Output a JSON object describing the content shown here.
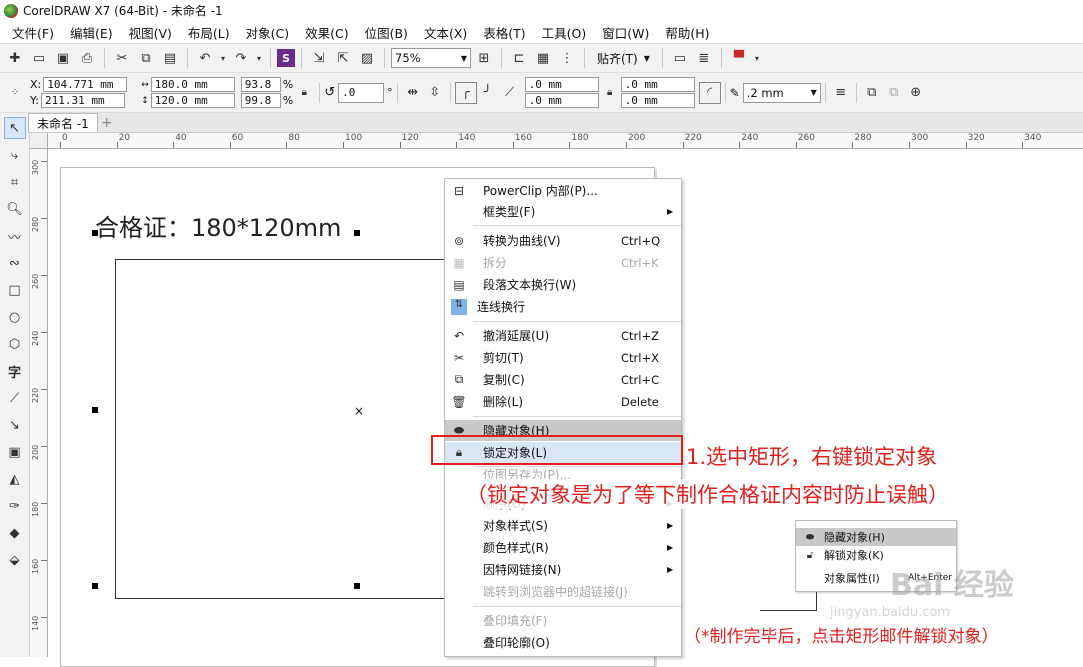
{
  "window": {
    "title": "CorelDRAW X7 (64-Bit) - 未命名 -1"
  },
  "menubar": [
    "文件(F)",
    "编辑(E)",
    "视图(V)",
    "布局(L)",
    "对象(C)",
    "效果(C)",
    "位图(B)",
    "文本(X)",
    "表格(T)",
    "工具(O)",
    "窗口(W)",
    "帮助(H)"
  ],
  "toolbar": {
    "zoom": "75%",
    "snap_label": "贴齐(T)"
  },
  "propbar": {
    "x_label": "X:",
    "x": "104.771 mm",
    "y_label": "Y:",
    "y": "211.31 mm",
    "width": "180.0 mm",
    "height": "120.0 mm",
    "scale_w": "93.8",
    "scale_h": "99.8",
    "percent": "%",
    "rotation": ".0",
    "degree": "°",
    "corner_tl": ".0 mm",
    "corner_bl": ".0 mm",
    "corner_tr": ".0 mm",
    "corner_br": ".0 mm",
    "outline": ".2 mm"
  },
  "doc_tab": {
    "label": "未命名 -1"
  },
  "ruler": {
    "h_ticks": [
      "0",
      "20",
      "40",
      "60",
      "80",
      "100",
      "120",
      "140",
      "160",
      "180",
      "200",
      "220",
      "240",
      "260",
      "280",
      "300",
      "320",
      "340"
    ],
    "v_ticks": [
      "300",
      "280",
      "260",
      "240",
      "220",
      "200",
      "180",
      "160",
      "140"
    ]
  },
  "canvas": {
    "page_title": "合格证：180*120mm"
  },
  "context_menu": {
    "items": [
      {
        "label": "PowerClip 内部(P)...",
        "shortcut": "",
        "icon": "powerclip-icon",
        "disabled": false,
        "submenu": false
      },
      {
        "label": "框类型(F)",
        "shortcut": "",
        "icon": "",
        "disabled": false,
        "submenu": true
      },
      {
        "label": "转换为曲线(V)",
        "shortcut": "Ctrl+Q",
        "icon": "curve-icon",
        "disabled": false,
        "submenu": false
      },
      {
        "label": "拆分",
        "shortcut": "Ctrl+K",
        "icon": "break-icon",
        "disabled": true,
        "submenu": false
      },
      {
        "label": "段落文本换行(W)",
        "shortcut": "",
        "icon": "wrap-icon",
        "disabled": false,
        "submenu": false
      },
      {
        "label": "连线换行",
        "shortcut": "",
        "icon": "connect-icon",
        "disabled": false,
        "submenu": false
      },
      {
        "label": "撤消延展(U)",
        "shortcut": "Ctrl+Z",
        "icon": "undo-icon",
        "disabled": false,
        "submenu": false
      },
      {
        "label": "剪切(T)",
        "shortcut": "Ctrl+X",
        "icon": "scissors-icon",
        "disabled": false,
        "submenu": false
      },
      {
        "label": "复制(C)",
        "shortcut": "Ctrl+C",
        "icon": "copy-icon",
        "disabled": false,
        "submenu": false
      },
      {
        "label": "删除(L)",
        "shortcut": "Delete",
        "icon": "trash-icon",
        "disabled": false,
        "submenu": false
      },
      {
        "label": "隐藏对象(H)",
        "shortcut": "",
        "icon": "eye-icon",
        "disabled": false,
        "submenu": false
      },
      {
        "label": "锁定对象(L)",
        "shortcut": "",
        "icon": "lock-icon",
        "disabled": false,
        "submenu": false
      },
      {
        "label": "位图另存为(P)...",
        "shortcut": "",
        "icon": "",
        "disabled": true,
        "submenu": false
      },
      {
        "label": "顺序(O)",
        "shortcut": "",
        "icon": "",
        "disabled": false,
        "submenu": true
      },
      {
        "label": "对象样式(S)",
        "shortcut": "",
        "icon": "",
        "disabled": false,
        "submenu": true
      },
      {
        "label": "颜色样式(R)",
        "shortcut": "",
        "icon": "",
        "disabled": false,
        "submenu": true
      },
      {
        "label": "因特网链接(N)",
        "shortcut": "",
        "icon": "",
        "disabled": false,
        "submenu": true
      },
      {
        "label": "跳转到浏览器中的超链接(J)",
        "shortcut": "",
        "icon": "",
        "disabled": true,
        "submenu": false
      },
      {
        "label": "叠印填充(F)",
        "shortcut": "",
        "icon": "",
        "disabled": true,
        "submenu": false
      },
      {
        "label": "叠印轮廓(O)",
        "shortcut": "",
        "icon": "",
        "disabled": false,
        "submenu": false
      }
    ]
  },
  "mini_menu": {
    "items": [
      {
        "label": "隐藏对象(H)",
        "shortcut": ""
      },
      {
        "label": "解锁对象(K)",
        "shortcut": ""
      },
      {
        "label": "对象属性(I)",
        "shortcut": "Alt+Enter"
      }
    ]
  },
  "annotations": {
    "step1": "1.选中矩形，右键锁定对象",
    "reason": "（锁定对象是为了等下制作合格证内容时防止误触）",
    "note": "（*制作完毕后，点击矩形邮件解锁对象）"
  },
  "watermark": {
    "text": "Bai 经验",
    "sub": "jingyan.baidu.com"
  },
  "colors": {
    "annotation_red": "#e0201f",
    "highlight": "#d9e6f4"
  }
}
